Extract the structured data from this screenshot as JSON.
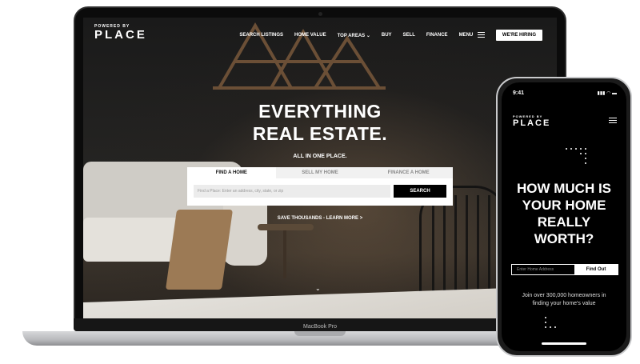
{
  "site": {
    "logo_small": "POWERED BY",
    "logo_big": "PLACE"
  },
  "nav": {
    "items": [
      "SEARCH LISTINGS",
      "HOME VALUE",
      "TOP AREAS ⌄",
      "BUY",
      "SELL",
      "FINANCE"
    ],
    "menu_label": "MENU",
    "hiring_label": "WE'RE HIRING"
  },
  "hero": {
    "title_line1": "EVERYTHING",
    "title_line2": "REAL ESTATE.",
    "subtitle": "ALL IN ONE PLACE.",
    "save_link": "SAVE THOUSANDS - LEARN MORE >",
    "chevron": "⌄"
  },
  "search": {
    "tabs": [
      "FIND A HOME",
      "SELL MY HOME",
      "FINANCE A HOME"
    ],
    "active_tab": 0,
    "input_placeholder": "Find a Place: Enter an address, city, state, or zip",
    "button_label": "SEARCH"
  },
  "device": {
    "laptop_label": "MacBook Pro"
  },
  "phone": {
    "time": "9:41",
    "status_icons": "▮▮▮ ◠ ▬",
    "logo_small": "POWERED BY",
    "logo_big": "PLACE",
    "title_line1": "HOW MUCH IS",
    "title_line2": "YOUR HOME",
    "title_line3": "REALLY",
    "title_line4": "WORTH?",
    "input_placeholder": "Enter Home Address",
    "button_label": "Find Out",
    "join_line1": "Join over 300,000 homeowners in",
    "join_line2": "finding your home's value"
  },
  "colors": {
    "brand_black": "#000000",
    "accent_white": "#ffffff"
  }
}
